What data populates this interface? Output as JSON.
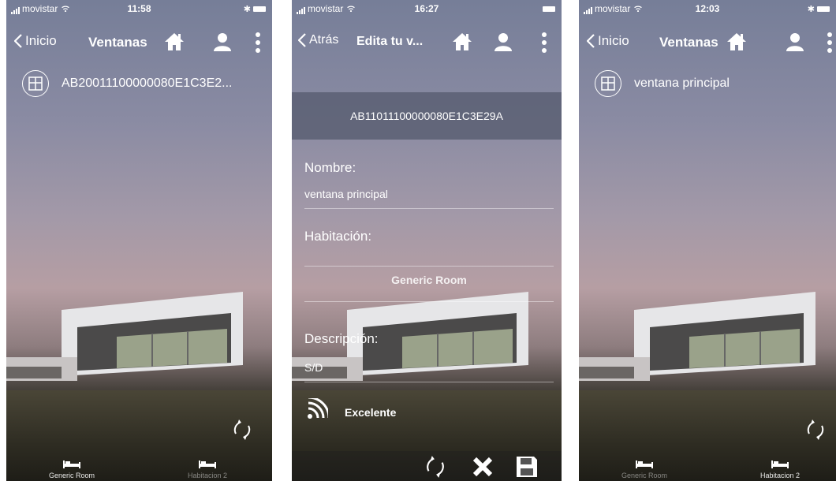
{
  "screens": [
    {
      "status": {
        "carrier": "movistar",
        "time": "11:58"
      },
      "nav": {
        "back": "Inicio",
        "title": "Ventanas"
      },
      "items": [
        {
          "label": "AB20011100000080E1C3E2..."
        }
      ],
      "tabs": [
        {
          "label": "Generic Room",
          "active": true
        },
        {
          "label": "Habitacion 2",
          "active": false
        }
      ]
    },
    {
      "status": {
        "carrier": "movistar",
        "time": "16:27"
      },
      "nav": {
        "back": "Atrás",
        "title": "Edita tu v..."
      },
      "device_id": "AB11011100000080E1C3E29A",
      "form": {
        "name_label": "Nombre:",
        "name_value": "ventana principal",
        "room_label": "Habitación:",
        "room_value": "Generic Room",
        "desc_label": "Descripción:",
        "desc_value": "S/D",
        "signal_label": "Excelente"
      }
    },
    {
      "status": {
        "carrier": "movistar",
        "time": "12:03"
      },
      "nav": {
        "back": "Inicio",
        "title": "Ventanas"
      },
      "items": [
        {
          "label": "ventana principal"
        }
      ],
      "tabs": [
        {
          "label": "Generic Room",
          "active": false
        },
        {
          "label": "Habitacion 2",
          "active": true
        }
      ]
    }
  ],
  "icons": {
    "home": "home-icon",
    "user": "user-icon",
    "menu": "more-vertical-icon",
    "window": "window-icon",
    "refresh": "refresh-icon",
    "bed": "bed-icon",
    "wifi_signal": "signal-icon",
    "cancel": "close-icon",
    "save": "save-icon"
  }
}
